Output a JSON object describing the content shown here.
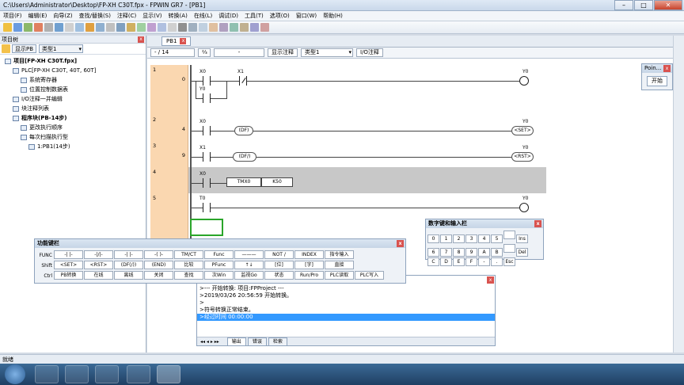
{
  "window": {
    "title": "C:\\Users\\Administrator\\Desktop\\FP-XH C30T.fpx - FPWIN GR7 - [PB1]"
  },
  "menu": [
    "项目(F)",
    "编辑(E)",
    "向导(Z)",
    "查找/替换(S)",
    "注释(C)",
    "显示(V)",
    "转换(A)",
    "在线(L)",
    "调试(D)",
    "工具(T)",
    "选项(O)",
    "窗口(W)",
    "帮助(H)"
  ],
  "tree": {
    "header": "项目树",
    "show_pb": "显示PB",
    "type_select": "类型1",
    "nodes": [
      {
        "label": "项目[FP-XH C30T.fpx]",
        "bold": true,
        "level": 0
      },
      {
        "label": "PLC[FP-XH C30T, 40T, 60T]",
        "bold": false,
        "level": 1
      },
      {
        "label": "系统寄存器",
        "bold": false,
        "level": 2
      },
      {
        "label": "位置控制数据表",
        "bold": false,
        "level": 2
      },
      {
        "label": "I/O注释一并编辑",
        "bold": false,
        "level": 1
      },
      {
        "label": "块注释列表",
        "bold": false,
        "level": 1
      },
      {
        "label": "程序块(PB-14步)",
        "bold": true,
        "level": 1
      },
      {
        "label": "更改执行顺序",
        "bold": false,
        "level": 2
      },
      {
        "label": "每次扫描执行型",
        "bold": false,
        "level": 2
      },
      {
        "label": "1:PB1(14步)",
        "bold": false,
        "level": 3
      }
    ]
  },
  "editor": {
    "tab": "PB1",
    "position": "- /  14",
    "field2": "-",
    "show_comment": "显示注释",
    "type": "类型1",
    "io_comment": "I/O注释"
  },
  "rungs": [
    {
      "num": "1",
      "step": "0"
    },
    {
      "num": "2",
      "step": "4"
    },
    {
      "num": "3",
      "step": "9"
    },
    {
      "num": "4",
      "step": ""
    },
    {
      "num": "5",
      "step": ""
    }
  ],
  "ladder": {
    "x0": "X0",
    "x1": "X1",
    "y0": "Y0",
    "y0b": "Y0",
    "x0r2": "X0",
    "df": "(DF)",
    "y0r2": "Y0",
    "set": "<SET>",
    "x1r3": "X1",
    "dfi": "(DF/)",
    "y0r3": "Y0",
    "rst": "<RST>",
    "x0r4": "X0",
    "tmx": "TMX0",
    "k": "K50",
    "t0": "T0",
    "y0r5": "Y0"
  },
  "point_panel": {
    "title": "Poin...",
    "start": "开始"
  },
  "numpad": {
    "title": "数字键和输入栏",
    "keys": [
      "0",
      "1",
      "2",
      "3",
      "4",
      "5",
      "",
      "Ins",
      "6",
      "7",
      "8",
      "9",
      "A",
      "B",
      "",
      "Del",
      "C",
      "D",
      "E",
      "F",
      "-",
      "."
    ],
    "esc": "Esc"
  },
  "funckeys": {
    "title": "功能键栏",
    "rows": [
      {
        "label": "FUNC",
        "keys": [
          "-| |-",
          "-|/|-",
          "-| |-",
          "-( )-",
          "TM/CT",
          "Func",
          "———",
          "NOT /",
          "INDEX",
          "指令输入"
        ]
      },
      {
        "label": "Shift",
        "keys": [
          "<SET>",
          "<RST>",
          "(DF(/))",
          "(END)",
          "比较",
          "PFunc",
          "↑↓",
          "[位]",
          "[字]",
          "直接"
        ]
      },
      {
        "label": "Ctrl",
        "keys": [
          "PB转换",
          "在线",
          "离线",
          "关闭",
          "查找",
          "次Win",
          "监视Go",
          "状态",
          "Run/Pro",
          "PLC读取",
          "PLC写入"
        ]
      }
    ]
  },
  "output": {
    "lines": [
      ">--- 开始转换: 项目:FPProject ---",
      ">2019/03/26 20:56:59 开始转换。",
      ">",
      ">符号转换正常结束。",
      ">经过时间 00:00:00"
    ],
    "tabs": [
      "输出",
      "错误",
      "检索"
    ]
  },
  "status": {
    "text": "就绪"
  },
  "colors": {
    "rung_num_bg": "#fad7b0",
    "selection": "#3399ff",
    "taskbar": "#1f3f63"
  }
}
